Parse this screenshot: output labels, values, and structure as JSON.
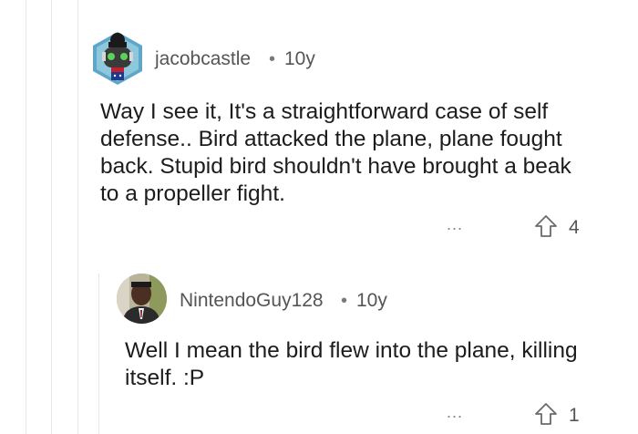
{
  "comments": [
    {
      "username": "jacobcastle",
      "separator": "•",
      "age": "10y",
      "body_lines": [
        "Way I see it, It's a straightforward case of self",
        "defense.. Bird attacked the plane, plane fought",
        "back. Stupid bird shouldn't have brought a beak",
        "to a propeller fight."
      ],
      "more": "...",
      "upvotes": "4",
      "avatar_icon": "robot-snoo-avatar"
    },
    {
      "username": "NintendoGuy128",
      "separator": "•",
      "age": "10y",
      "body_lines": [
        "Well I mean the bird flew into the plane, killing",
        "itself. :P"
      ],
      "more": "...",
      "upvotes": "1",
      "avatar_icon": "person-photo-avatar"
    }
  ],
  "colors": {
    "thread_line": "#e6e6e6",
    "meta_text": "#555555",
    "body_text": "#1c1c1c"
  }
}
